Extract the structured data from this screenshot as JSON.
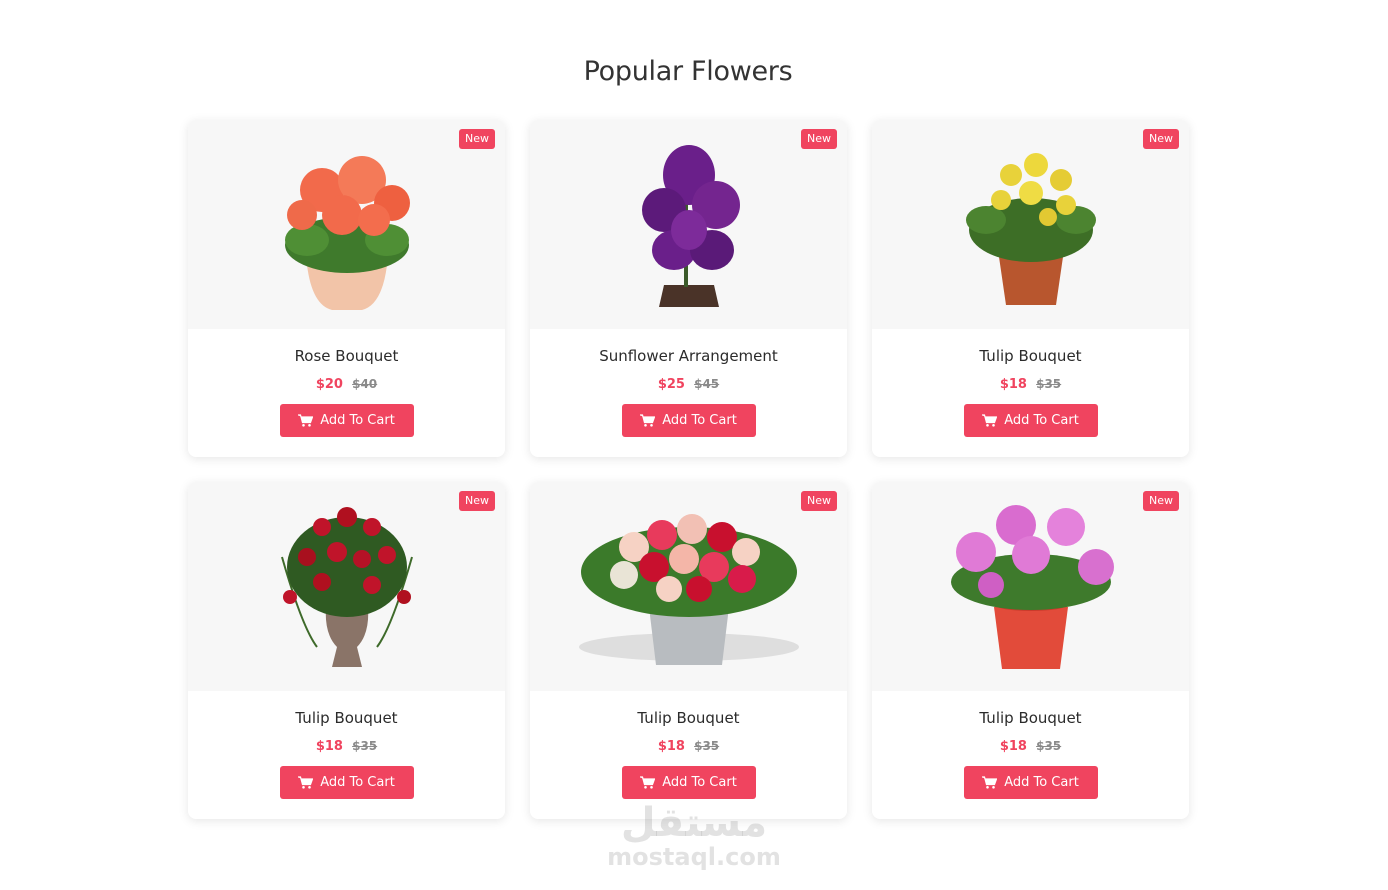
{
  "section": {
    "title": "Popular Flowers"
  },
  "theme": {
    "accent": "#f0445f",
    "card_media_bg": "#f7f7f7"
  },
  "products": [
    {
      "name": "Rose Bouquet",
      "price": "$20",
      "old_price": "$40",
      "badge": "New",
      "button_label": "Add To Cart",
      "image": "orange-geranium-pot",
      "petal": "#f26a4b",
      "pot": "#f2c4a8"
    },
    {
      "name": "Sunflower Arrangement",
      "price": "$25",
      "old_price": "$45",
      "badge": "New",
      "button_label": "Add To Cart",
      "image": "purple-orchid-pot",
      "petal": "#6a1f8a",
      "pot": "#4a3328"
    },
    {
      "name": "Tulip Bouquet",
      "price": "$18",
      "old_price": "$35",
      "badge": "New",
      "button_label": "Add To Cart",
      "image": "yellow-primrose-pot",
      "petal": "#e8d23a",
      "pot": "#b8562e"
    },
    {
      "name": "Tulip Bouquet",
      "price": "$18",
      "old_price": "$35",
      "badge": "New",
      "button_label": "Add To Cart",
      "image": "red-flowers-urn",
      "petal": "#c0142a",
      "pot": "#8a7468"
    },
    {
      "name": "Tulip Bouquet",
      "price": "$18",
      "old_price": "$35",
      "badge": "New",
      "button_label": "Add To Cart",
      "image": "mixed-roses-bucket",
      "petal": "#e83a5c",
      "pot": "#b8bcc0"
    },
    {
      "name": "Tulip Bouquet",
      "price": "$18",
      "old_price": "$35",
      "badge": "New",
      "button_label": "Add To Cart",
      "image": "pink-hydrangea-pot",
      "petal": "#e07ad6",
      "pot": "#e24b3a"
    }
  ],
  "watermark": {
    "logo": "مستقل",
    "url": "mostaql.com"
  }
}
